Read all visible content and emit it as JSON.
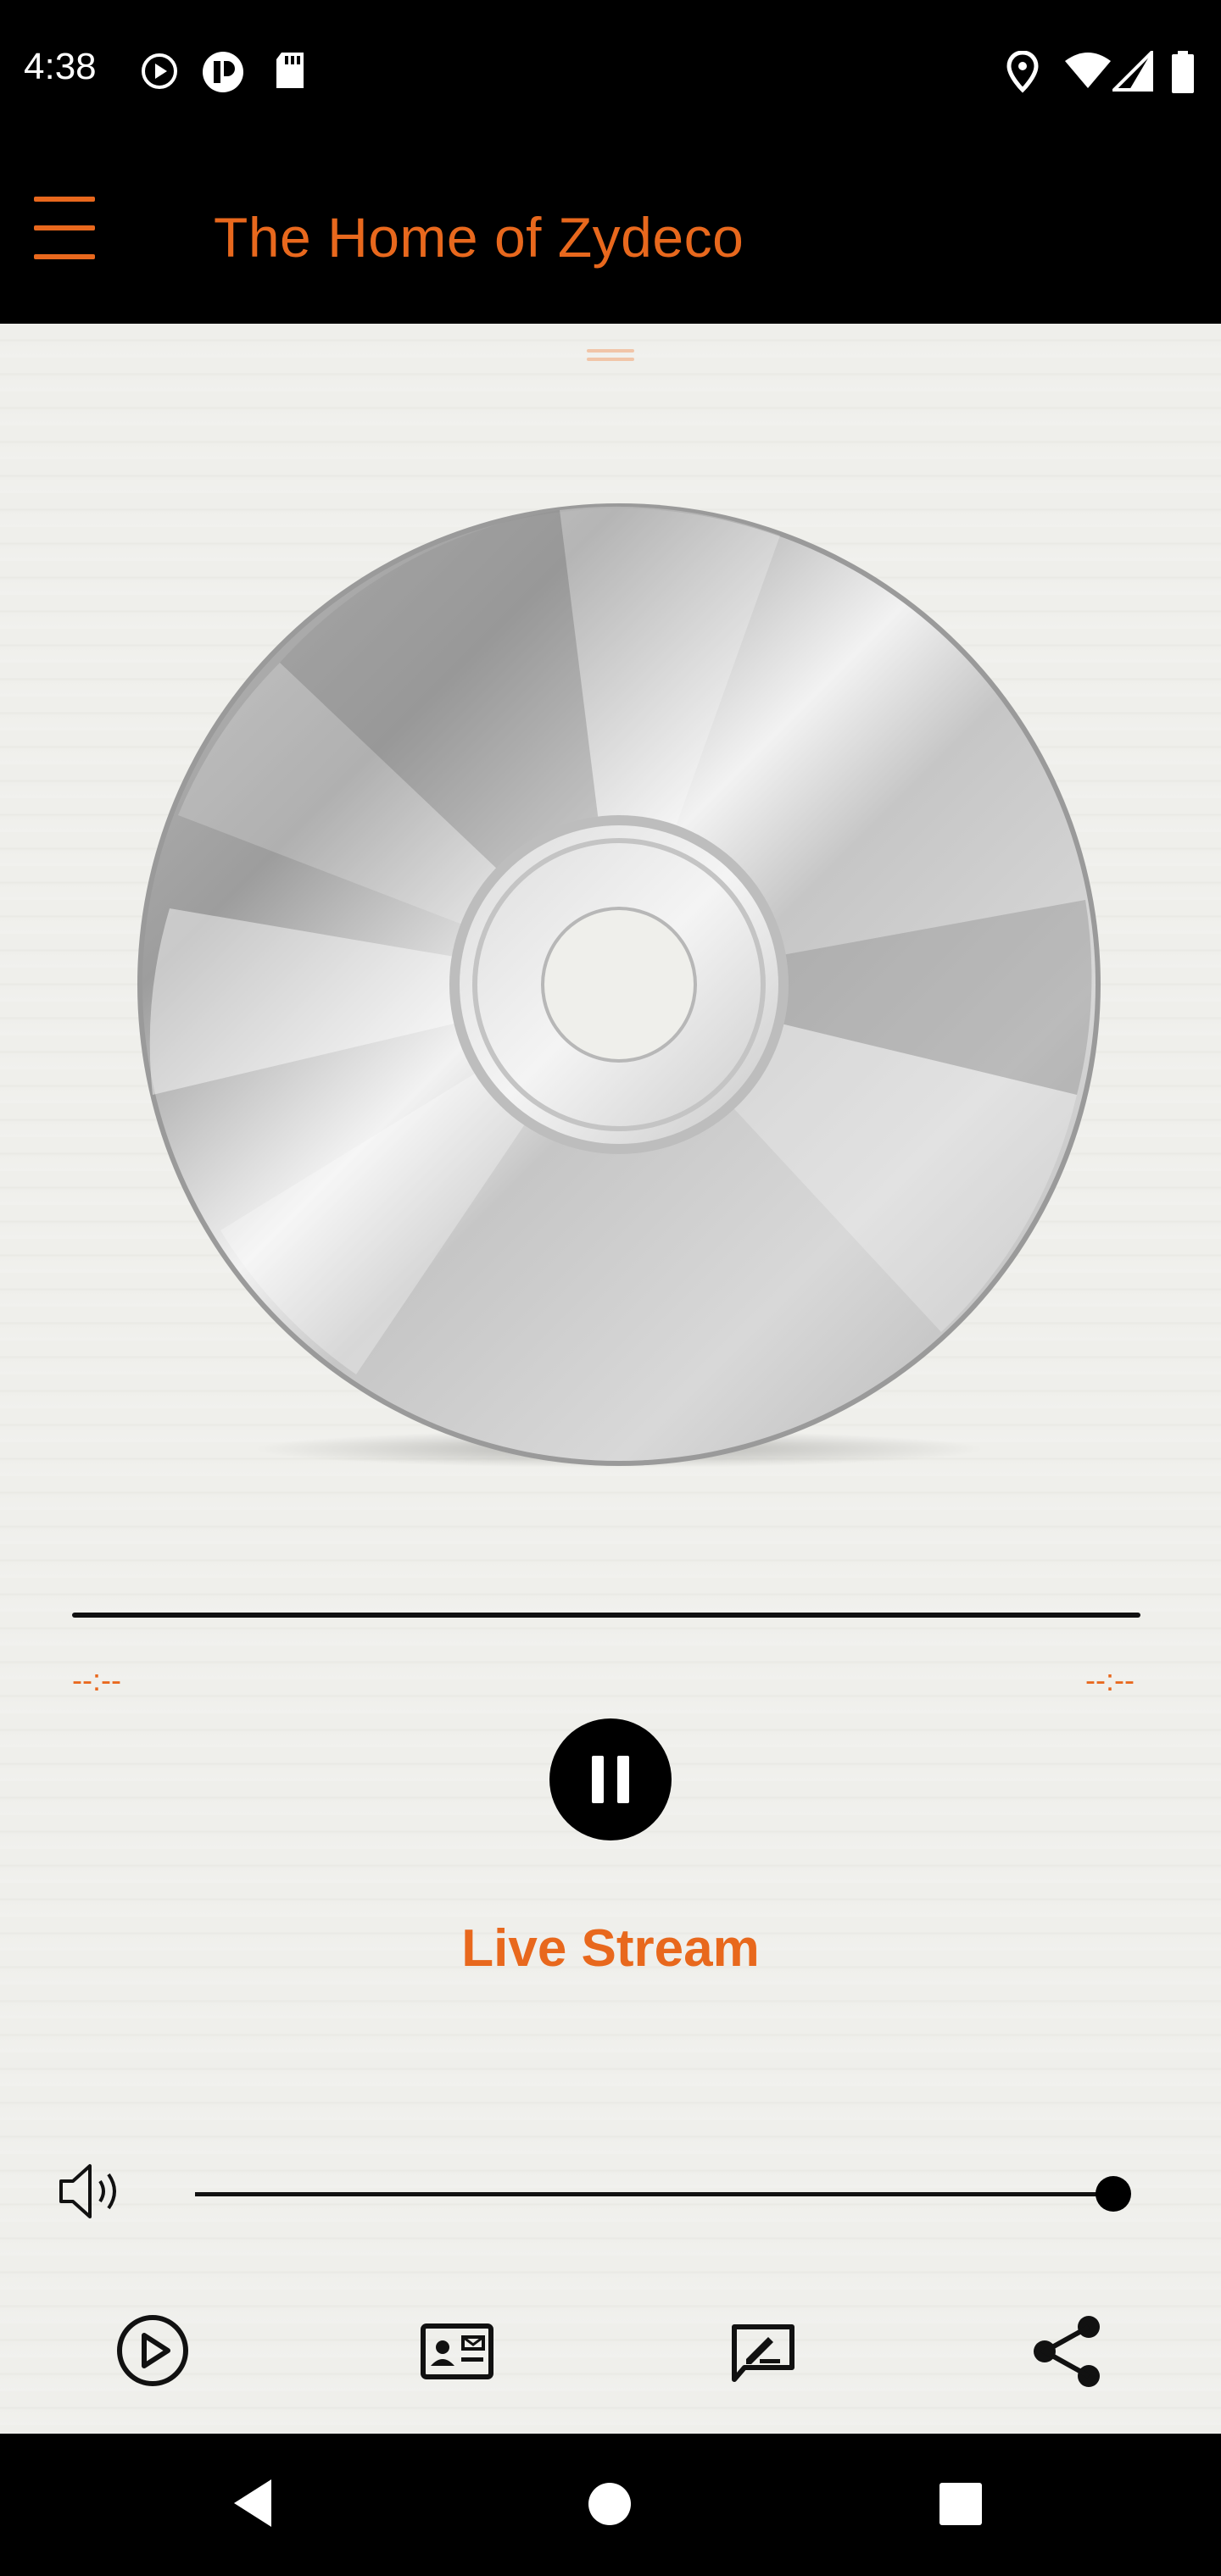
{
  "status_bar": {
    "time": "4:38",
    "left_icons": [
      "play-circle-icon",
      "notification-app-icon",
      "sd-card-icon"
    ],
    "right_icons": [
      "location-icon",
      "wifi-icon",
      "signal-icon",
      "battery-icon"
    ]
  },
  "app_bar": {
    "title": "The Home of Zydeco",
    "menu_icon": "hamburger-menu-icon"
  },
  "player": {
    "artwork": "cd-disc",
    "elapsed": "--:--",
    "duration": "--:--",
    "progress": 0,
    "state": "playing",
    "station_label": "Live Stream",
    "volume": 1.0
  },
  "actions": [
    {
      "icon": "play-circle-icon",
      "name": "player-tab"
    },
    {
      "icon": "contact-card-icon",
      "name": "contact-tab"
    },
    {
      "icon": "feedback-edit-icon",
      "name": "feedback-tab"
    },
    {
      "icon": "share-icon",
      "name": "share-tab"
    }
  ],
  "nav": {
    "back": "back-icon",
    "home": "home-icon",
    "recents": "recents-icon"
  },
  "colors": {
    "accent": "#e8681d",
    "bars": "#000000",
    "content_bg": "#efefeb"
  }
}
